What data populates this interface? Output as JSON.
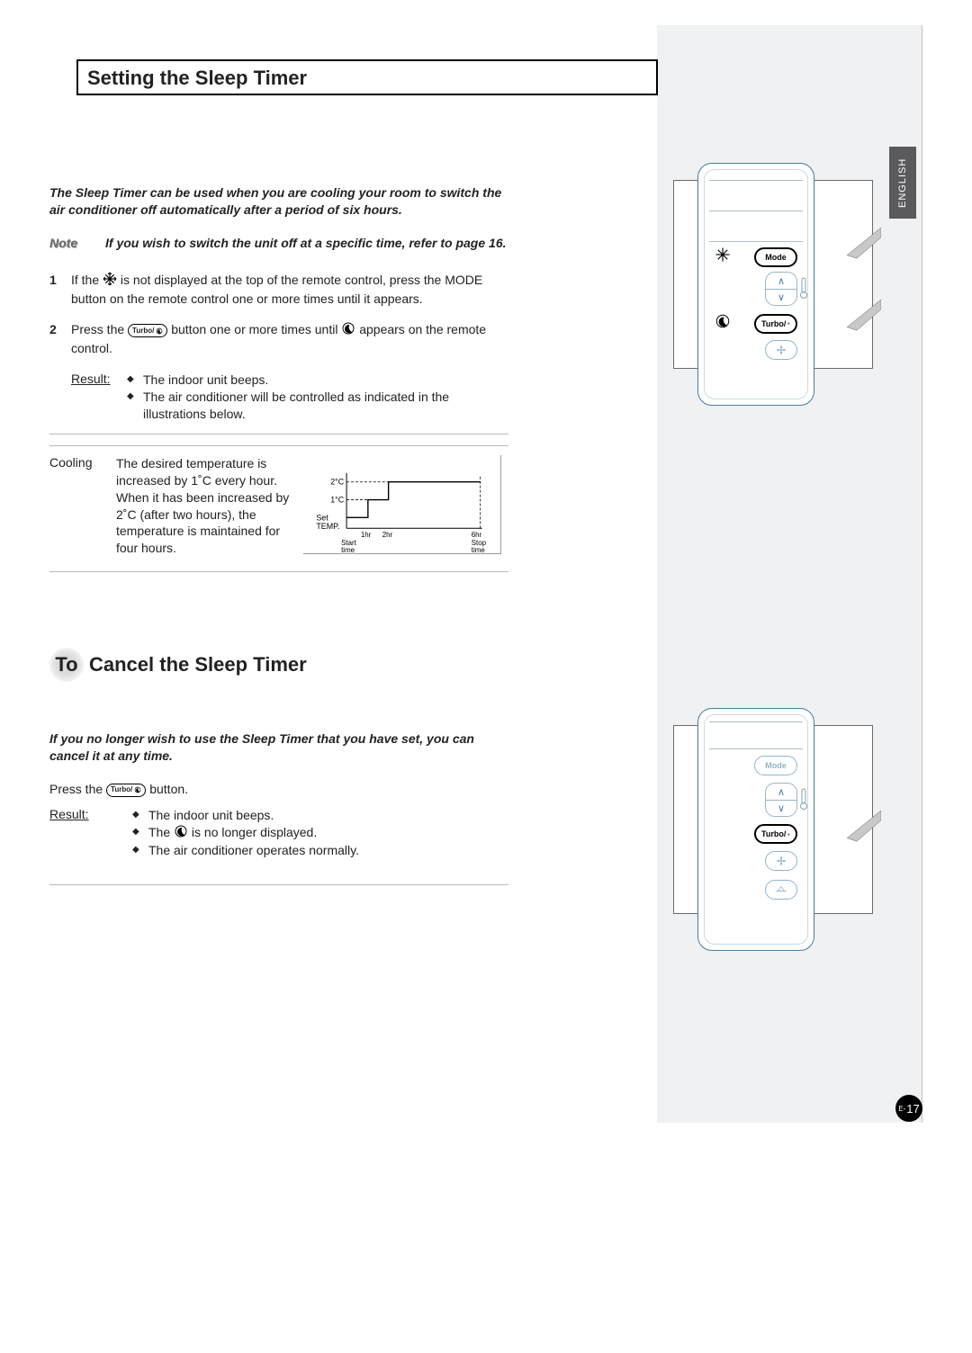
{
  "lang_tab": "ENGLISH",
  "title": "Setting the Sleep Timer",
  "intro": "The Sleep Timer can be used when you are cooling your room to switch the air conditioner off automatically after a period of six hours.",
  "note_label": "Note",
  "note_text": "If you wish to switch the unit off at a specific time, refer to page 16.",
  "steps": {
    "s1_num": "1",
    "s1_a": "If the",
    "s1_b": "is not displayed at the top of the remote control, press the MODE button on the remote control one or more times until it appears.",
    "s2_num": "2",
    "s2_a": "Press the",
    "s2_b": "button one or more times until",
    "s2_c": "appears on the remote control."
  },
  "result_label": "Result:",
  "result1": {
    "i1": "The indoor unit beeps.",
    "i2": "The air conditioner will be controlled as indicated in the illustrations below."
  },
  "cooling_label": "Cooling",
  "cooling_text": "The desired temperature is increased by 1˚C every hour. When it has been increased by 2˚C (after two hours), the temperature is maintained for four hours.",
  "section2_to": "To",
  "section2_title": "Cancel the Sleep Timer",
  "cancel_intro": "If you no longer wish to use the Sleep Timer that you have set, you can cancel it at any time.",
  "cancel_press_a": "Press the",
  "cancel_press_b": "button.",
  "result2": {
    "i1": "The indoor unit beeps.",
    "i2a": "The",
    "i2b": "is no longer displayed.",
    "i3": "The air conditioner operates normally."
  },
  "remote": {
    "mode": "Mode",
    "turbo": "Turbo/"
  },
  "chart_data": {
    "type": "line",
    "title": "",
    "xlabel": "",
    "ylabel": "Set TEMP.",
    "x_ticks": [
      "Start time",
      "1hr",
      "2hr",
      "6hr"
    ],
    "y_ticks": [
      "1°C",
      "2°C"
    ],
    "annotations": [
      "Start time",
      "Stop time"
    ],
    "series": [
      {
        "name": "temp-offset",
        "x": [
          0,
          1,
          2,
          6
        ],
        "y": [
          0,
          1,
          2,
          2
        ]
      }
    ],
    "ylim": [
      0,
      2.3
    ],
    "xlim": [
      0,
      6
    ]
  },
  "chart_labels": {
    "y2": "2°C",
    "y1": "1°C",
    "set": "Set",
    "temp": "TEMP.",
    "h1": "1hr",
    "h2": "2hr",
    "h6": "6hr",
    "start": "Start\ntime",
    "stop": "Stop\ntime"
  },
  "page_e": "E-",
  "page_num": "17"
}
